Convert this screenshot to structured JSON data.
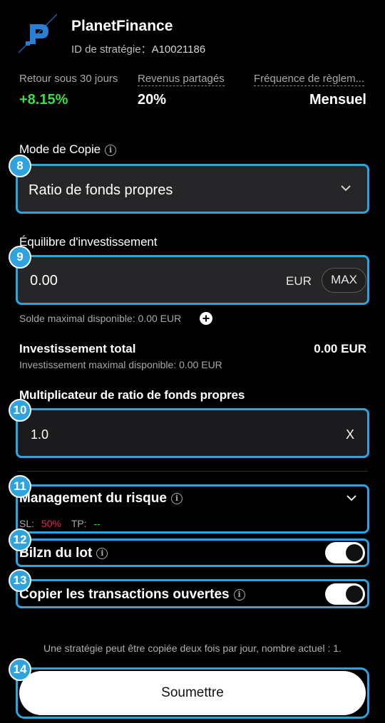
{
  "header": {
    "app_name": "PlanetFinance",
    "strategy_id_label": "ID de stratégie：",
    "strategy_id_value": "A10021186"
  },
  "stats": [
    {
      "label": "Retour sous 30 jours",
      "value": "+8.15%",
      "color": "#3ddc4a"
    },
    {
      "label": "Revenus partagés",
      "value": "20%"
    },
    {
      "label": "Fréquence de règlem...",
      "value": "Mensuel"
    }
  ],
  "copy_mode": {
    "label": "Mode de Copie",
    "badge": "8",
    "selected": "Ratio de fonds propres"
  },
  "investment_balance": {
    "label": "Équilibre d'investissement",
    "badge": "9",
    "value": "0.00",
    "currency": "EUR",
    "max_label": "MAX",
    "available_text": "Solde maximal disponible: 0.00 EUR"
  },
  "total_investment": {
    "label": "Investissement total",
    "value": "0.00 EUR",
    "max_text": "Investissement maximal disponible: 0.00 EUR"
  },
  "multiplier": {
    "label": "Multiplicateur de ratio de fonds propres",
    "badge": "10",
    "value": "1.0",
    "unit": "X"
  },
  "risk": {
    "badge": "11",
    "label": "Management du risque",
    "sl_label": "SL:",
    "sl_value": "50%",
    "tp_label": "TP:",
    "tp_value": "--"
  },
  "lot_balance": {
    "badge": "12",
    "label": "Bilzn du lot",
    "enabled": true
  },
  "copy_open": {
    "badge": "13",
    "label": "Copier les transactions ouvertes",
    "enabled": true
  },
  "notice": "Une stratégie peut être copiée deux fois par jour, nombre actuel : 1.",
  "submit": {
    "badge": "14",
    "label": "Soumettre"
  },
  "colors": {
    "accent": "#2ea3dd",
    "positive": "#3ddc4a",
    "sl": "#e8264b",
    "tp": "#3ddc4a"
  }
}
